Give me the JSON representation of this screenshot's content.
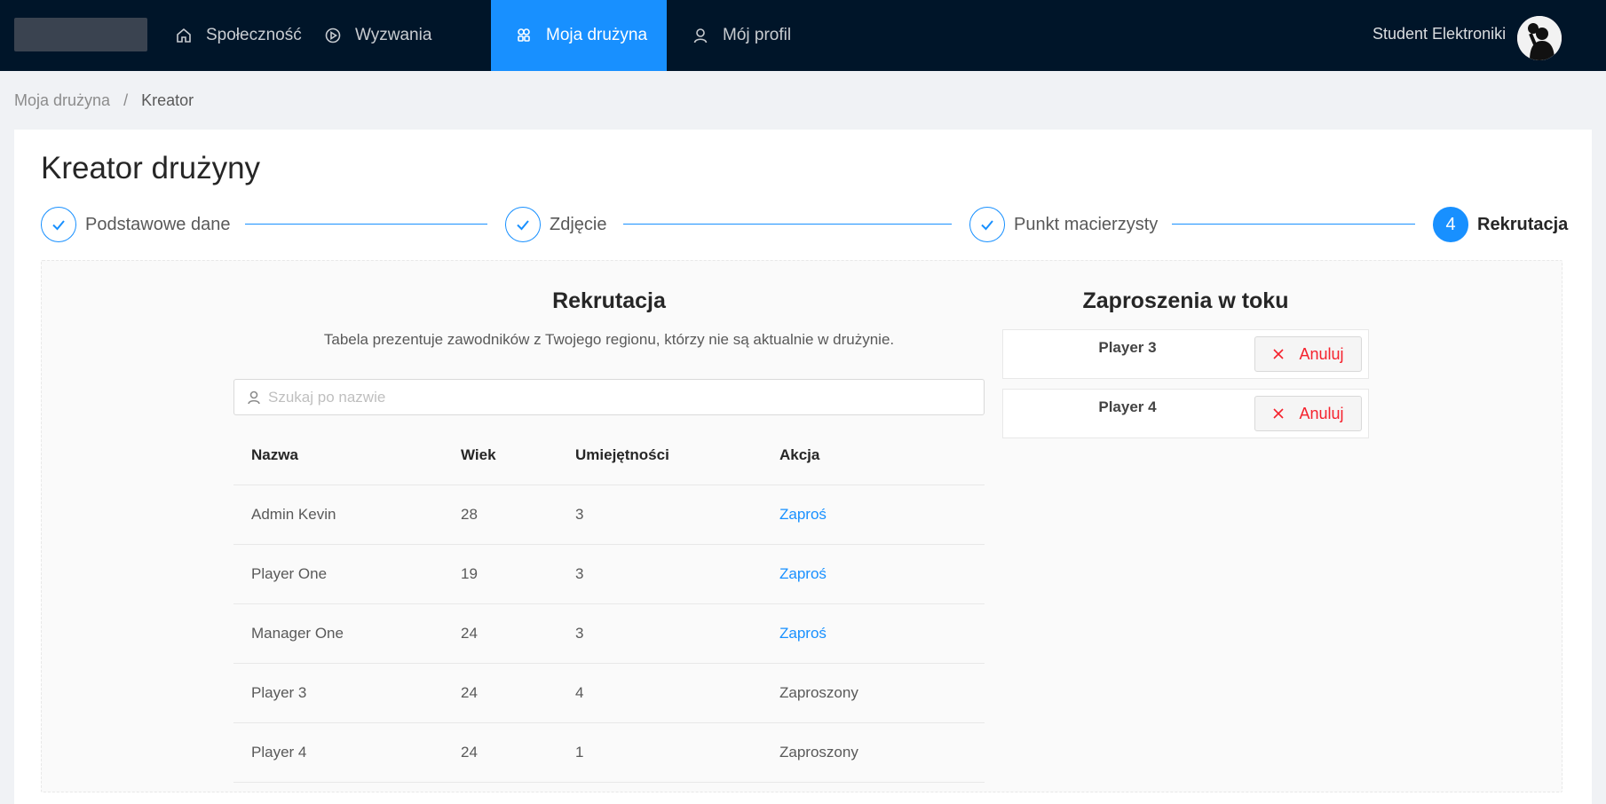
{
  "nav": {
    "items": [
      {
        "label": "Społeczność",
        "icon": "home-icon"
      },
      {
        "label": "Wyzwania",
        "icon": "play-circle-icon"
      },
      {
        "label": "Moja drużyna",
        "icon": "team-icon",
        "active": true
      },
      {
        "label": "Mój profil",
        "icon": "user-icon"
      }
    ],
    "user_name": "Student Elektroniki"
  },
  "breadcrumb": {
    "items": [
      "Moja drużyna",
      "Kreator"
    ],
    "separator": "/"
  },
  "page": {
    "title": "Kreator drużyny"
  },
  "steps": [
    {
      "title": "Podstawowe dane",
      "status": "finished"
    },
    {
      "title": "Zdjęcie",
      "status": "finished"
    },
    {
      "title": "Punkt macierzysty",
      "status": "finished"
    },
    {
      "number": "4",
      "title": "Rekrutacja",
      "status": "active"
    }
  ],
  "recruitment": {
    "title": "Rekrutacja",
    "description": "Tabela prezentuje zawodników z Twojego regionu, którzy nie są aktualnie w drużynie.",
    "search_placeholder": "Szukaj po nazwie",
    "columns": [
      "Nazwa",
      "Wiek",
      "Umiejętności",
      "Akcja"
    ],
    "rows": [
      {
        "name": "Admin Kevin",
        "age": "28",
        "skill": "3",
        "action": "Zaproś",
        "action_type": "link"
      },
      {
        "name": "Player One",
        "age": "19",
        "skill": "3",
        "action": "Zaproś",
        "action_type": "link"
      },
      {
        "name": "Manager One",
        "age": "24",
        "skill": "3",
        "action": "Zaproś",
        "action_type": "link"
      },
      {
        "name": "Player 3",
        "age": "24",
        "skill": "4",
        "action": "Zaproszony",
        "action_type": "text"
      },
      {
        "name": "Player 4",
        "age": "24",
        "skill": "1",
        "action": "Zaproszony",
        "action_type": "text"
      }
    ]
  },
  "invitations": {
    "title": "Zaproszenia w toku",
    "items": [
      {
        "name": "Player 3",
        "cancel_label": "Anuluj"
      },
      {
        "name": "Player 4",
        "cancel_label": "Anuluj"
      }
    ]
  },
  "colors": {
    "nav_bg": "#001529",
    "accent": "#1890ff",
    "danger": "#f5222d"
  }
}
